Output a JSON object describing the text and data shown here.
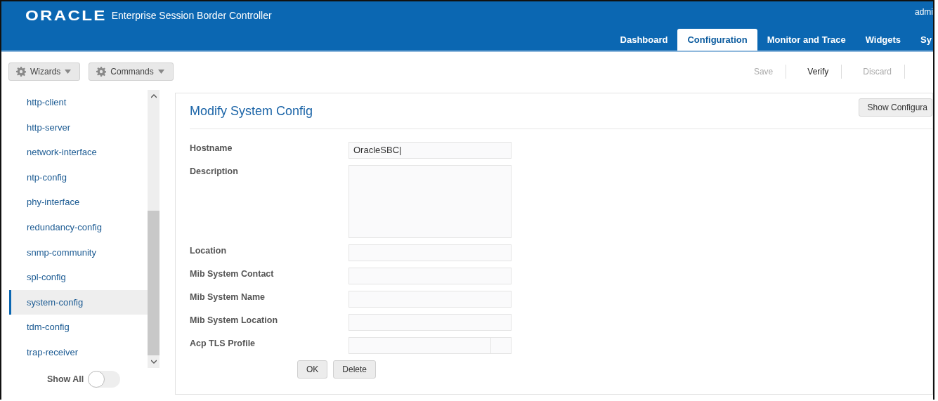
{
  "header": {
    "logo": "ORACLE",
    "product": "Enterprise Session Border Controller",
    "user": "admi"
  },
  "tabs": [
    {
      "label": "Dashboard",
      "selected": false
    },
    {
      "label": "Configuration",
      "selected": true
    },
    {
      "label": "Monitor and Trace",
      "selected": false
    },
    {
      "label": "Widgets",
      "selected": false
    },
    {
      "label": "Sy",
      "selected": false
    }
  ],
  "toolbar": {
    "menus": [
      "Wizards",
      "Commands"
    ],
    "actions": [
      {
        "label": "Save",
        "disabled": true
      },
      {
        "label": "Verify",
        "disabled": false
      },
      {
        "label": "Discard",
        "disabled": true
      }
    ]
  },
  "sidebar": {
    "items": [
      {
        "label": "http-client",
        "selected": false
      },
      {
        "label": "http-server",
        "selected": false
      },
      {
        "label": "network-interface",
        "selected": false
      },
      {
        "label": "ntp-config",
        "selected": false
      },
      {
        "label": "phy-interface",
        "selected": false
      },
      {
        "label": "redundancy-config",
        "selected": false
      },
      {
        "label": "snmp-community",
        "selected": false
      },
      {
        "label": "spl-config",
        "selected": false
      },
      {
        "label": "system-config",
        "selected": true
      },
      {
        "label": "tdm-config",
        "selected": false
      },
      {
        "label": "trap-receiver",
        "selected": false
      }
    ],
    "show_all": {
      "label": "Show All",
      "on": false
    }
  },
  "panel": {
    "title": "Modify System Config",
    "show_button": "Show Configura",
    "fields": [
      {
        "label": "Hostname",
        "kind": "text",
        "value": "OracleSBC|"
      },
      {
        "label": "Description",
        "kind": "textarea"
      },
      {
        "label": "Location",
        "kind": "text"
      },
      {
        "label": "Mib System Contact",
        "kind": "text"
      },
      {
        "label": "Mib System Name",
        "kind": "text"
      },
      {
        "label": "Mib System Location",
        "kind": "text"
      },
      {
        "label": "Acp TLS Profile",
        "kind": "select"
      }
    ],
    "buttons": [
      "OK",
      "Delete"
    ]
  }
}
